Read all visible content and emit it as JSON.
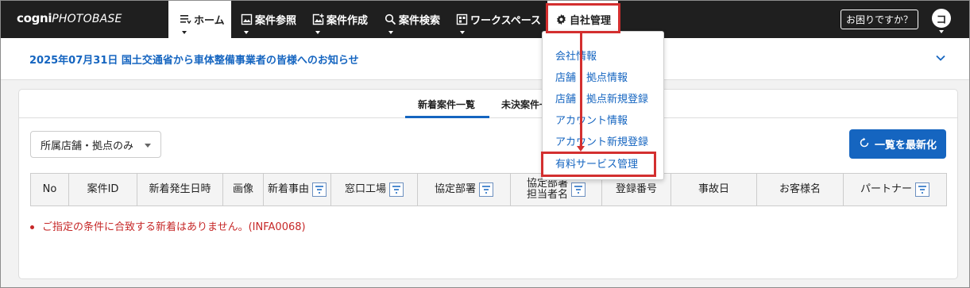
{
  "header": {
    "logo_bold": "cogni",
    "logo_italic": "PHOTOBASE",
    "nav": [
      {
        "label": "ホーム",
        "icon": "list-icon"
      },
      {
        "label": "案件参照",
        "icon": "image-icon"
      },
      {
        "label": "案件作成",
        "icon": "image-add-icon"
      },
      {
        "label": "案件検索",
        "icon": "search-icon"
      },
      {
        "label": "ワークスペース",
        "icon": "workspace-icon"
      },
      {
        "label": "自社管理",
        "icon": "gear-icon"
      }
    ],
    "help_label": "お困りですか？",
    "avatar_initial": "コ"
  },
  "notice": {
    "text": "2025年07月31日  国土交通省から車体整備事業者の皆様へのお知らせ"
  },
  "main": {
    "tabs": [
      {
        "label": "新着案件一覧"
      },
      {
        "label": "未決案件一"
      }
    ],
    "store_select_value": "所属店舗・拠点のみ",
    "refresh_label": "一覧を最新化",
    "columns": [
      "No",
      "案件ID",
      "新着発生日時",
      "画像",
      "新着事由",
      "窓口工場",
      "協定部署",
      "協定部署\n担当者名",
      "登録番号",
      "事故日",
      "お客様名",
      "パートナー"
    ],
    "empty_message": "ご指定の条件に合致する新着はありません。(INFA0068)"
  },
  "dropdown": {
    "items": [
      "会社情報",
      "店舗・拠点情報",
      "店舗・拠点新規登録",
      "アカウント情報",
      "アカウント新規登録",
      "有料サービス管理"
    ]
  },
  "colors": {
    "accent": "#1565c0",
    "header_bg": "#1f1f1f",
    "error": "#c62828",
    "annotation": "#d32f2f"
  }
}
